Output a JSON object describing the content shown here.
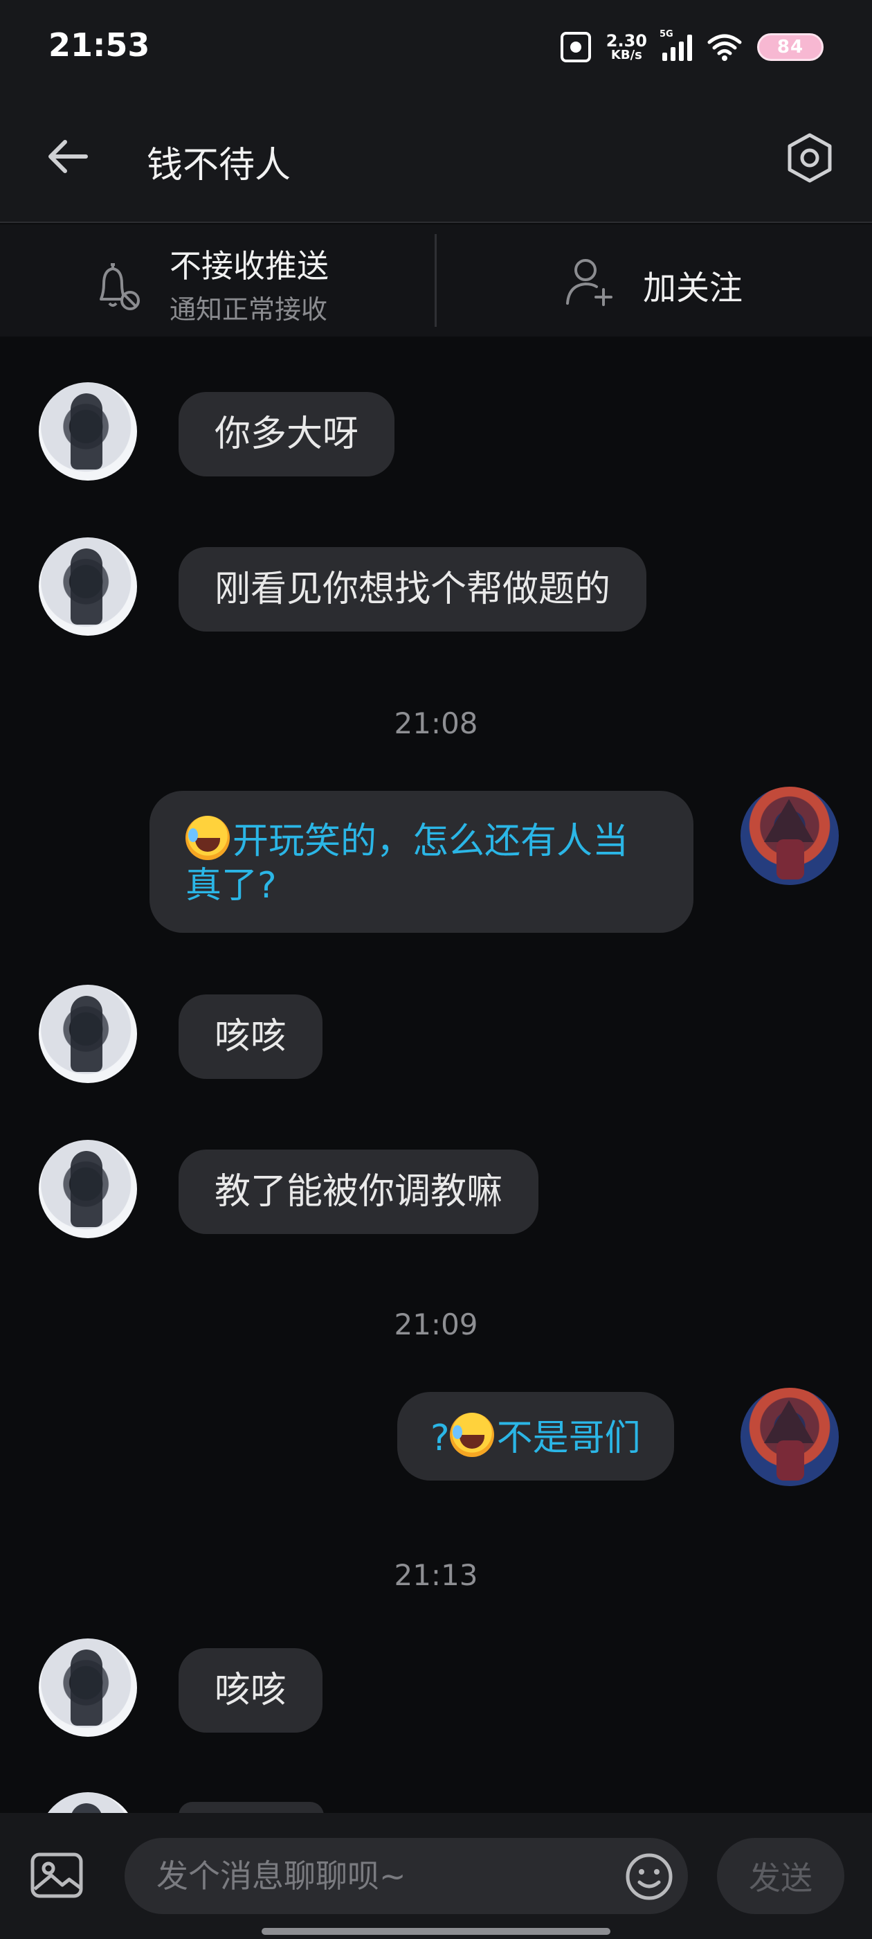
{
  "status_bar": {
    "time": "21:53",
    "net_speed_value": "2.30",
    "net_speed_unit": "KB/s",
    "network_type": "5G",
    "battery": "84"
  },
  "header": {
    "title": "钱不待人"
  },
  "actions": {
    "push_title": "不接收推送",
    "push_subtitle": "通知正常接收",
    "follow_label": "加关注"
  },
  "messages": [
    {
      "sender": "other",
      "text": "你多大呀"
    },
    {
      "sender": "other",
      "text": "刚看见你想找个帮做题的"
    },
    {
      "type": "timestamp",
      "text": "21:08"
    },
    {
      "sender": "me",
      "text": "开玩笑的，怎么还有人当真了?"
    },
    {
      "sender": "other",
      "text": "咳咳"
    },
    {
      "sender": "other",
      "text": "教了能被你调教嘛"
    },
    {
      "type": "timestamp",
      "text": "21:09"
    },
    {
      "sender": "me",
      "text_prefix": "?",
      "text": "不是哥们"
    },
    {
      "type": "timestamp",
      "text": "21:13"
    },
    {
      "sender": "other",
      "text": "咳咳"
    }
  ],
  "composer": {
    "placeholder": "发个消息聊聊呗~",
    "send_label": "发送"
  },
  "colors": {
    "background": "#0b0c0e",
    "bubble": "#2b2c30",
    "my_text": "#2bb6e6",
    "header": "#17181b"
  }
}
